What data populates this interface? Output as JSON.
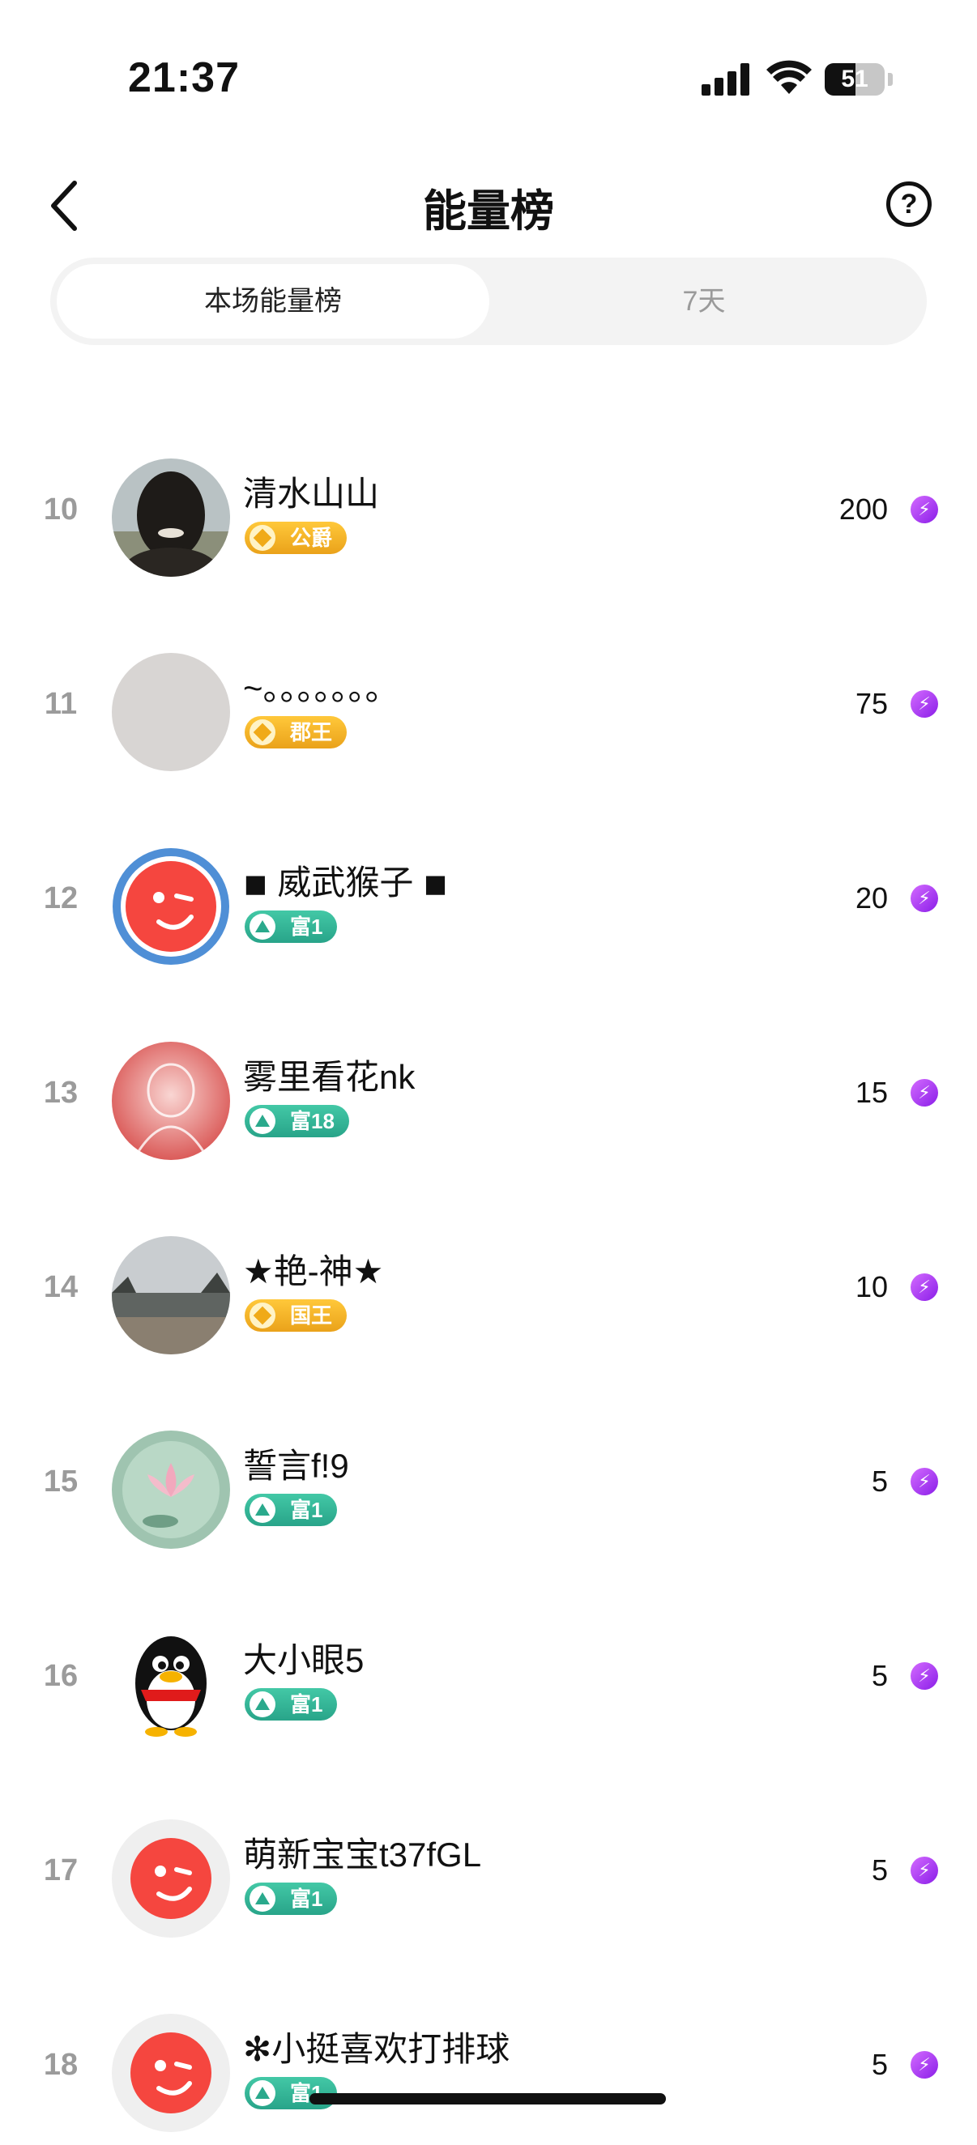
{
  "status": {
    "time": "21:37",
    "battery": "51"
  },
  "header": {
    "title": "能量榜",
    "help": "?"
  },
  "tabs": [
    {
      "label": "本场能量榜",
      "active": true
    },
    {
      "label": "7天",
      "active": false
    }
  ],
  "colors": {
    "gold_badge": "#f0aa18",
    "teal_badge": "#2aa98c",
    "rank_gray": "#9b9b9b",
    "energy_purple": "#a43ff2"
  },
  "rows": [
    {
      "rank": "10",
      "name": "清水山山",
      "badge": "公爵",
      "badge_type": "gold",
      "score": "200",
      "avatar": "dark-portrait"
    },
    {
      "rank": "11",
      "name": "~。。。。。。。",
      "badge": "郡王",
      "badge_type": "gold",
      "score": "75",
      "avatar": "blank-gray"
    },
    {
      "rank": "12",
      "name": "◾ 威武猴子 ◾",
      "badge": "富1",
      "badge_type": "teal",
      "score": "20",
      "avatar": "red-wink-frame"
    },
    {
      "rank": "13",
      "name": "雾里看花nk",
      "badge": "富18",
      "badge_type": "teal",
      "score": "15",
      "avatar": "pink-buddha"
    },
    {
      "rank": "14",
      "name": "★艳-神★",
      "badge": "国王",
      "badge_type": "gold",
      "score": "10",
      "avatar": "winter-landscape"
    },
    {
      "rank": "15",
      "name": "誓言f!9",
      "badge": "富1",
      "badge_type": "teal",
      "score": "5",
      "avatar": "lotus"
    },
    {
      "rank": "16",
      "name": "大小眼5",
      "badge": "富1",
      "badge_type": "teal",
      "score": "5",
      "avatar": "penguin"
    },
    {
      "rank": "17",
      "name": "萌新宝宝t37fGL",
      "badge": "富1",
      "badge_type": "teal",
      "score": "5",
      "avatar": "red-wink"
    },
    {
      "rank": "18",
      "name": "✻小挺喜欢打排球",
      "badge": "富1",
      "badge_type": "teal",
      "score": "5",
      "avatar": "red-wink"
    }
  ]
}
